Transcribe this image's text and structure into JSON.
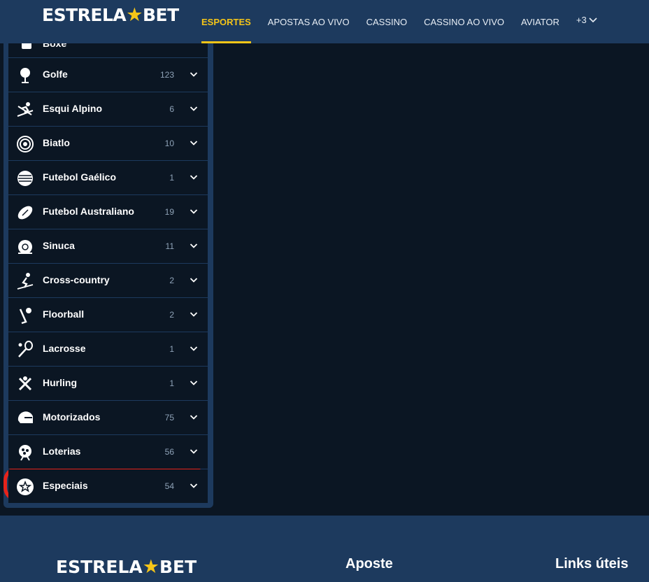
{
  "header": {
    "logo_left": "ESTRELA",
    "logo_star": "★",
    "logo_right": "BET",
    "nav": [
      {
        "label": "ESPORTES",
        "active": true
      },
      {
        "label": "APOSTAS AO VIVO",
        "active": false
      },
      {
        "label": "CASSINO",
        "active": false
      },
      {
        "label": "CASSINO AO VIVO",
        "active": false
      },
      {
        "label": "AVIATOR",
        "active": false
      }
    ],
    "more_label": "+3"
  },
  "sidebar": {
    "partial_item_label": "Boxe",
    "items": [
      {
        "label": "Golfe",
        "count": "123",
        "icon": "golf-icon"
      },
      {
        "label": "Esqui Alpino",
        "count": "6",
        "icon": "ski-icon"
      },
      {
        "label": "Biatlo",
        "count": "10",
        "icon": "target-icon"
      },
      {
        "label": "Futebol Gaélico",
        "count": "1",
        "icon": "gaelic-ball-icon"
      },
      {
        "label": "Futebol Australiano",
        "count": "19",
        "icon": "oval-ball-icon"
      },
      {
        "label": "Sinuca",
        "count": "11",
        "icon": "snooker-icon"
      },
      {
        "label": "Cross-country",
        "count": "2",
        "icon": "cross-country-icon"
      },
      {
        "label": "Floorball",
        "count": "2",
        "icon": "floorball-icon"
      },
      {
        "label": "Lacrosse",
        "count": "1",
        "icon": "lacrosse-icon"
      },
      {
        "label": "Hurling",
        "count": "1",
        "icon": "hurling-icon"
      },
      {
        "label": "Motorizados",
        "count": "75",
        "icon": "helmet-icon"
      },
      {
        "label": "Loterias",
        "count": "56",
        "icon": "lottery-icon"
      },
      {
        "label": "Especiais",
        "count": "54",
        "icon": "star-badge-icon"
      }
    ]
  },
  "footer": {
    "logo_left": "ESTRELA",
    "logo_star": "★",
    "logo_right": "BET",
    "col1_title": "Aposte",
    "col2_title": "Links úteis"
  },
  "colors": {
    "accent": "#f5c518",
    "header_bg": "#1d3a5e",
    "page_bg": "#0b1623",
    "highlight": "#e8231a"
  }
}
